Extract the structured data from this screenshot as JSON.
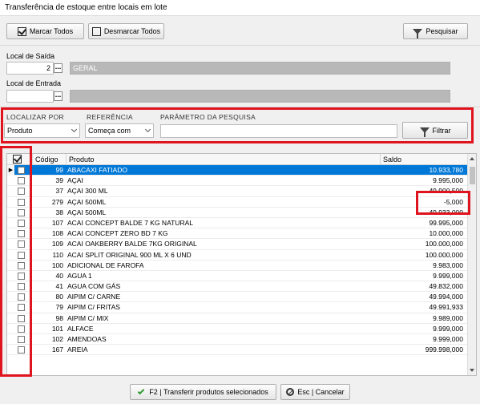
{
  "window": {
    "title": "Transferência de estoque entre locais em lote"
  },
  "toolbar": {
    "mark_all": "Marcar Todos",
    "unmark_all": "Desmarcar Todos",
    "search": "Pesquisar"
  },
  "origin": {
    "label": "Local de Saída",
    "code": "2",
    "name": "GERAL"
  },
  "destination": {
    "label": "Local de Entrada",
    "code": "",
    "name": ""
  },
  "filter": {
    "locate_by_label": "LOCALIZAR POR",
    "locate_by_value": "Produto",
    "reference_label": "REFERÊNCIA",
    "reference_value": "Começa com",
    "param_label": "PARÂMETRO DA PESQUISA",
    "param_value": "",
    "filter_button": "Filtrar"
  },
  "grid": {
    "columns": {
      "code": "Código",
      "product": "Produto",
      "balance": "Saldo"
    },
    "rows": [
      {
        "code": "99",
        "product": "ABACAXI FATIADO",
        "balance": "10.933,780",
        "selected": true
      },
      {
        "code": "39",
        "product": "AÇAI",
        "balance": "9.995,000"
      },
      {
        "code": "37",
        "product": "AÇAI 300 ML",
        "balance": "49.900,500"
      },
      {
        "code": "279",
        "product": "AÇAI 500ML",
        "balance": "-5,000"
      },
      {
        "code": "38",
        "product": "AÇAI 500ML",
        "balance": "49.933,000"
      },
      {
        "code": "107",
        "product": "ACAI CONCEPT BALDE 7 KG NATURAL",
        "balance": "99.995,000"
      },
      {
        "code": "108",
        "product": "ACAI CONCEPT ZERO BD 7 KG",
        "balance": "10.000,000"
      },
      {
        "code": "109",
        "product": "ACAI OAKBERRY BALDE 7KG ORIGINAL",
        "balance": "100.000,000"
      },
      {
        "code": "110",
        "product": "ACAI SPLIT ORIGINAL 900 ML X 6 UND",
        "balance": "100.000,000"
      },
      {
        "code": "100",
        "product": "ADICIONAL DE FAROFA",
        "balance": "9.983,000"
      },
      {
        "code": "40",
        "product": "AGUA 1",
        "balance": "9.999,000"
      },
      {
        "code": "41",
        "product": "AGUA COM GÁS",
        "balance": "49.832,000"
      },
      {
        "code": "80",
        "product": "AIPIM C/ CARNE",
        "balance": "49.994,000"
      },
      {
        "code": "79",
        "product": "AIPIM C/ FRITAS",
        "balance": "49.991,933"
      },
      {
        "code": "98",
        "product": "AIPIM C/ MIX",
        "balance": "9.989,000"
      },
      {
        "code": "101",
        "product": "ALFACE",
        "balance": "9.999,000"
      },
      {
        "code": "102",
        "product": "AMENDOAS",
        "balance": "9.999,000"
      },
      {
        "code": "167",
        "product": "AREIA",
        "balance": "999.998,000"
      }
    ]
  },
  "footer": {
    "transfer": "F2 | Transferir produtos selecionados",
    "cancel": "Esc | Cancelar"
  },
  "colors": {
    "selection": "#0078d7",
    "highlight_box": "#e0141e"
  }
}
